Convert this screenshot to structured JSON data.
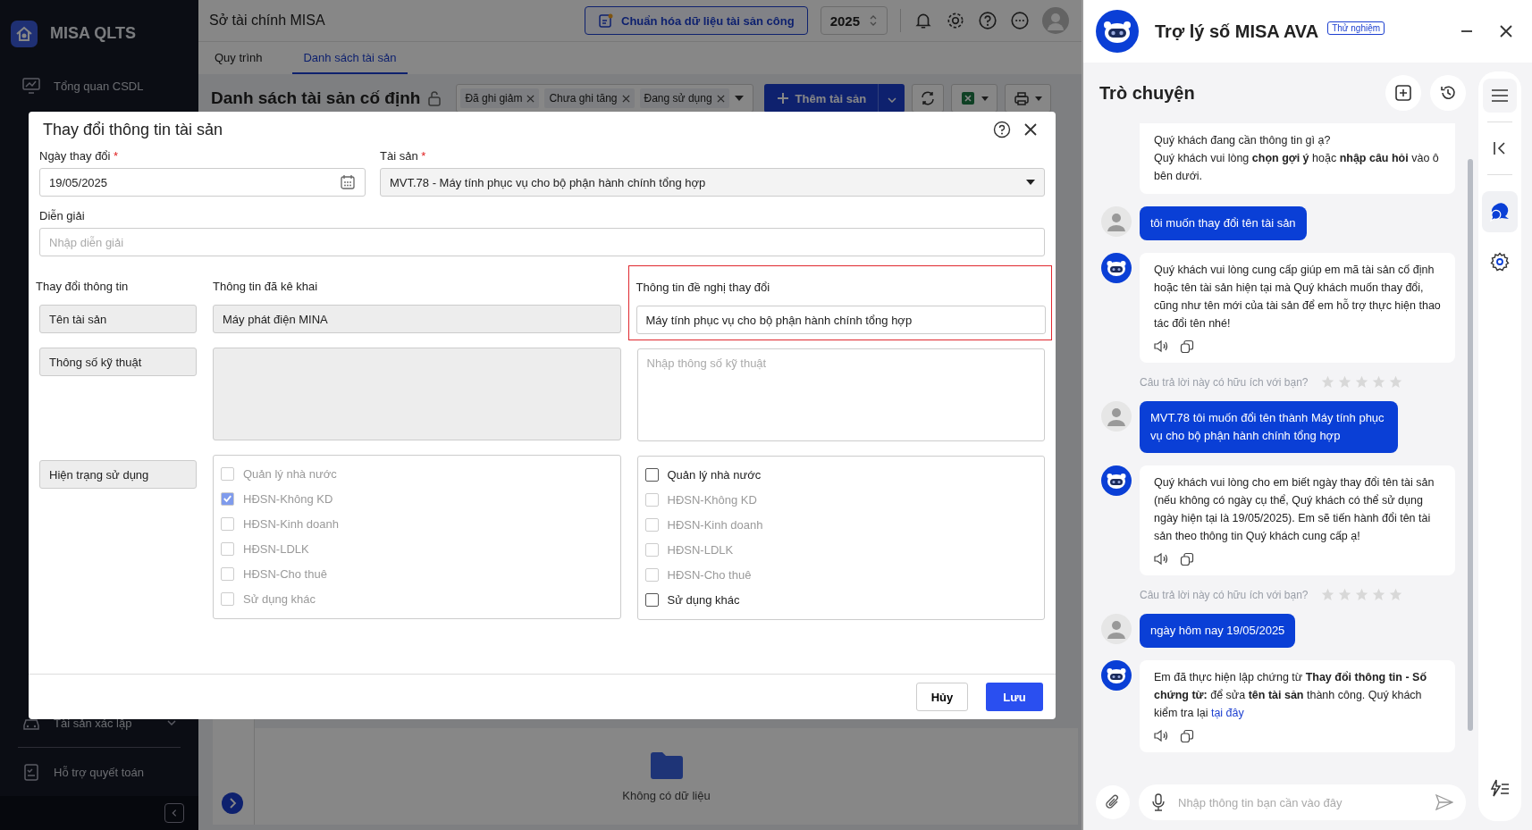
{
  "sidebar": {
    "logo": "MISA QLTS",
    "overview_item": "Tổng quan CSDL",
    "asset_group": {
      "label": "Tài sản xác lập",
      "expanded": false
    },
    "support_item": "Hỗ trợ quyết toán"
  },
  "header": {
    "org": "Sở tài chính MISA",
    "standardize_button": "Chuẩn hóa dữ liệu tài sản công",
    "year": "2025"
  },
  "tabs": [
    {
      "label": "Quy trình",
      "selected": false
    },
    {
      "label": "Danh sách tài sản",
      "selected": true
    }
  ],
  "toolbar": {
    "title": "Danh sách tài sản cố định",
    "filters": [
      "Đã ghi giảm",
      "Chưa ghi tăng",
      "Đang sử dụng"
    ],
    "add_button": "Thêm tài sản"
  },
  "table": {
    "empty_text": "Không có dữ liệu"
  },
  "dialog": {
    "title": "Thay đổi thông tin tài sản",
    "required_mark": "*",
    "date": {
      "label": "Ngày thay đổi",
      "required": true,
      "value": "19/05/2025"
    },
    "asset": {
      "label": "Tài sản",
      "required": true,
      "value": "MVT.78 - Máy tính phục vụ cho bộ phận hành chính tổng hợp"
    },
    "description": {
      "label": "Diễn giải",
      "placeholder": "Nhập diễn giải"
    },
    "columns": [
      "Thay đổi thông tin",
      "Thông tin đã kê khai",
      "Thông tin đề nghị thay đổi"
    ],
    "proposed_highlighted": true,
    "name_row": {
      "label": "Tên tài sản",
      "declared": "Máy phát điện MINA",
      "proposed": "Máy tính phục vụ cho bộ phận hành chính tổng hợp"
    },
    "spec_row": {
      "label": "Thông số kỹ thuật",
      "proposed_placeholder": "Nhập thông số kỹ thuật"
    },
    "status_row": {
      "label": "Hiện trạng sử dụng",
      "declared": [
        {
          "label": "Quản lý nhà nước",
          "checked": false,
          "disabled": true
        },
        {
          "label": "HĐSN-Không KD",
          "checked": true,
          "disabled": true
        },
        {
          "label": "HĐSN-Kinh doanh",
          "checked": false,
          "disabled": true
        },
        {
          "label": "HĐSN-LDLK",
          "checked": false,
          "disabled": true
        },
        {
          "label": "HĐSN-Cho thuê",
          "checked": false,
          "disabled": true
        },
        {
          "label": "Sử dụng khác",
          "checked": false,
          "disabled": true
        }
      ],
      "proposed": [
        {
          "label": "Quản lý nhà nước",
          "checked": false,
          "disabled": false
        },
        {
          "label": "HĐSN-Không KD",
          "checked": false,
          "disabled": true
        },
        {
          "label": "HĐSN-Kinh doanh",
          "checked": false,
          "disabled": true
        },
        {
          "label": "HĐSN-LDLK",
          "checked": false,
          "disabled": true
        },
        {
          "label": "HĐSN-Cho thuê",
          "checked": false,
          "disabled": true
        },
        {
          "label": "Sử dụng khác",
          "checked": false,
          "disabled": false
        }
      ]
    },
    "cancel_button": "Hủy",
    "save_button": "Lưu"
  },
  "chat": {
    "title": "Trợ lý số MISA AVA",
    "badge": "Thử nghiệm",
    "section_title": "Trò chuyện",
    "messages": [
      {
        "kind": "bot",
        "avatar": false,
        "actions": false,
        "text": "Quý khách đang cần thông tin gì ạ?\nQuý khách vui lòng **chọn gợi ý** hoặc **nhập câu hỏi** vào ô bên dưới."
      },
      {
        "kind": "user",
        "text": "tôi muốn thay đổi tên tài sản"
      },
      {
        "kind": "bot",
        "avatar": true,
        "actions": true,
        "text": "Quý khách vui lòng cung cấp giúp em mã tài sản cố định hoặc tên tài sản hiện tại mà Quý khách muốn thay đổi, cũng như tên mới của tài sản để em hỗ trợ thực hiện thao tác đổi tên nhé!"
      },
      {
        "kind": "rating",
        "text": "Câu trả lời này có hữu ích với bạn?",
        "stars": 0
      },
      {
        "kind": "user",
        "text": "MVT.78 tôi muốn đổi tên thành Máy tính phục vụ cho bộ phận hành chính tổng hợp"
      },
      {
        "kind": "bot",
        "avatar": true,
        "actions": true,
        "text": "Quý khách vui lòng cho em biết ngày thay đổi tên tài sản (nếu không có ngày cụ thể, Quý khách có thể sử dụng ngày hiện tại là 19/05/2025). Em sẽ tiến hành đổi tên tài sản theo thông tin Quý khách cung cấp ạ!"
      },
      {
        "kind": "rating",
        "text": "Câu trả lời này có hữu ích với bạn?",
        "stars": 0
      },
      {
        "kind": "user",
        "text": "ngày hôm nay 19/05/2025"
      },
      {
        "kind": "bot",
        "avatar": true,
        "actions": true,
        "text": "Em đã thực hiện lập chứng từ **Thay đổi thông tin - Số chứng từ:** để sửa **tên tài sản** thành công. Quý khách kiểm tra lại ",
        "link": "tại đây"
      }
    ],
    "input_placeholder": "Nhập thông tin bạn cần vào đây"
  }
}
